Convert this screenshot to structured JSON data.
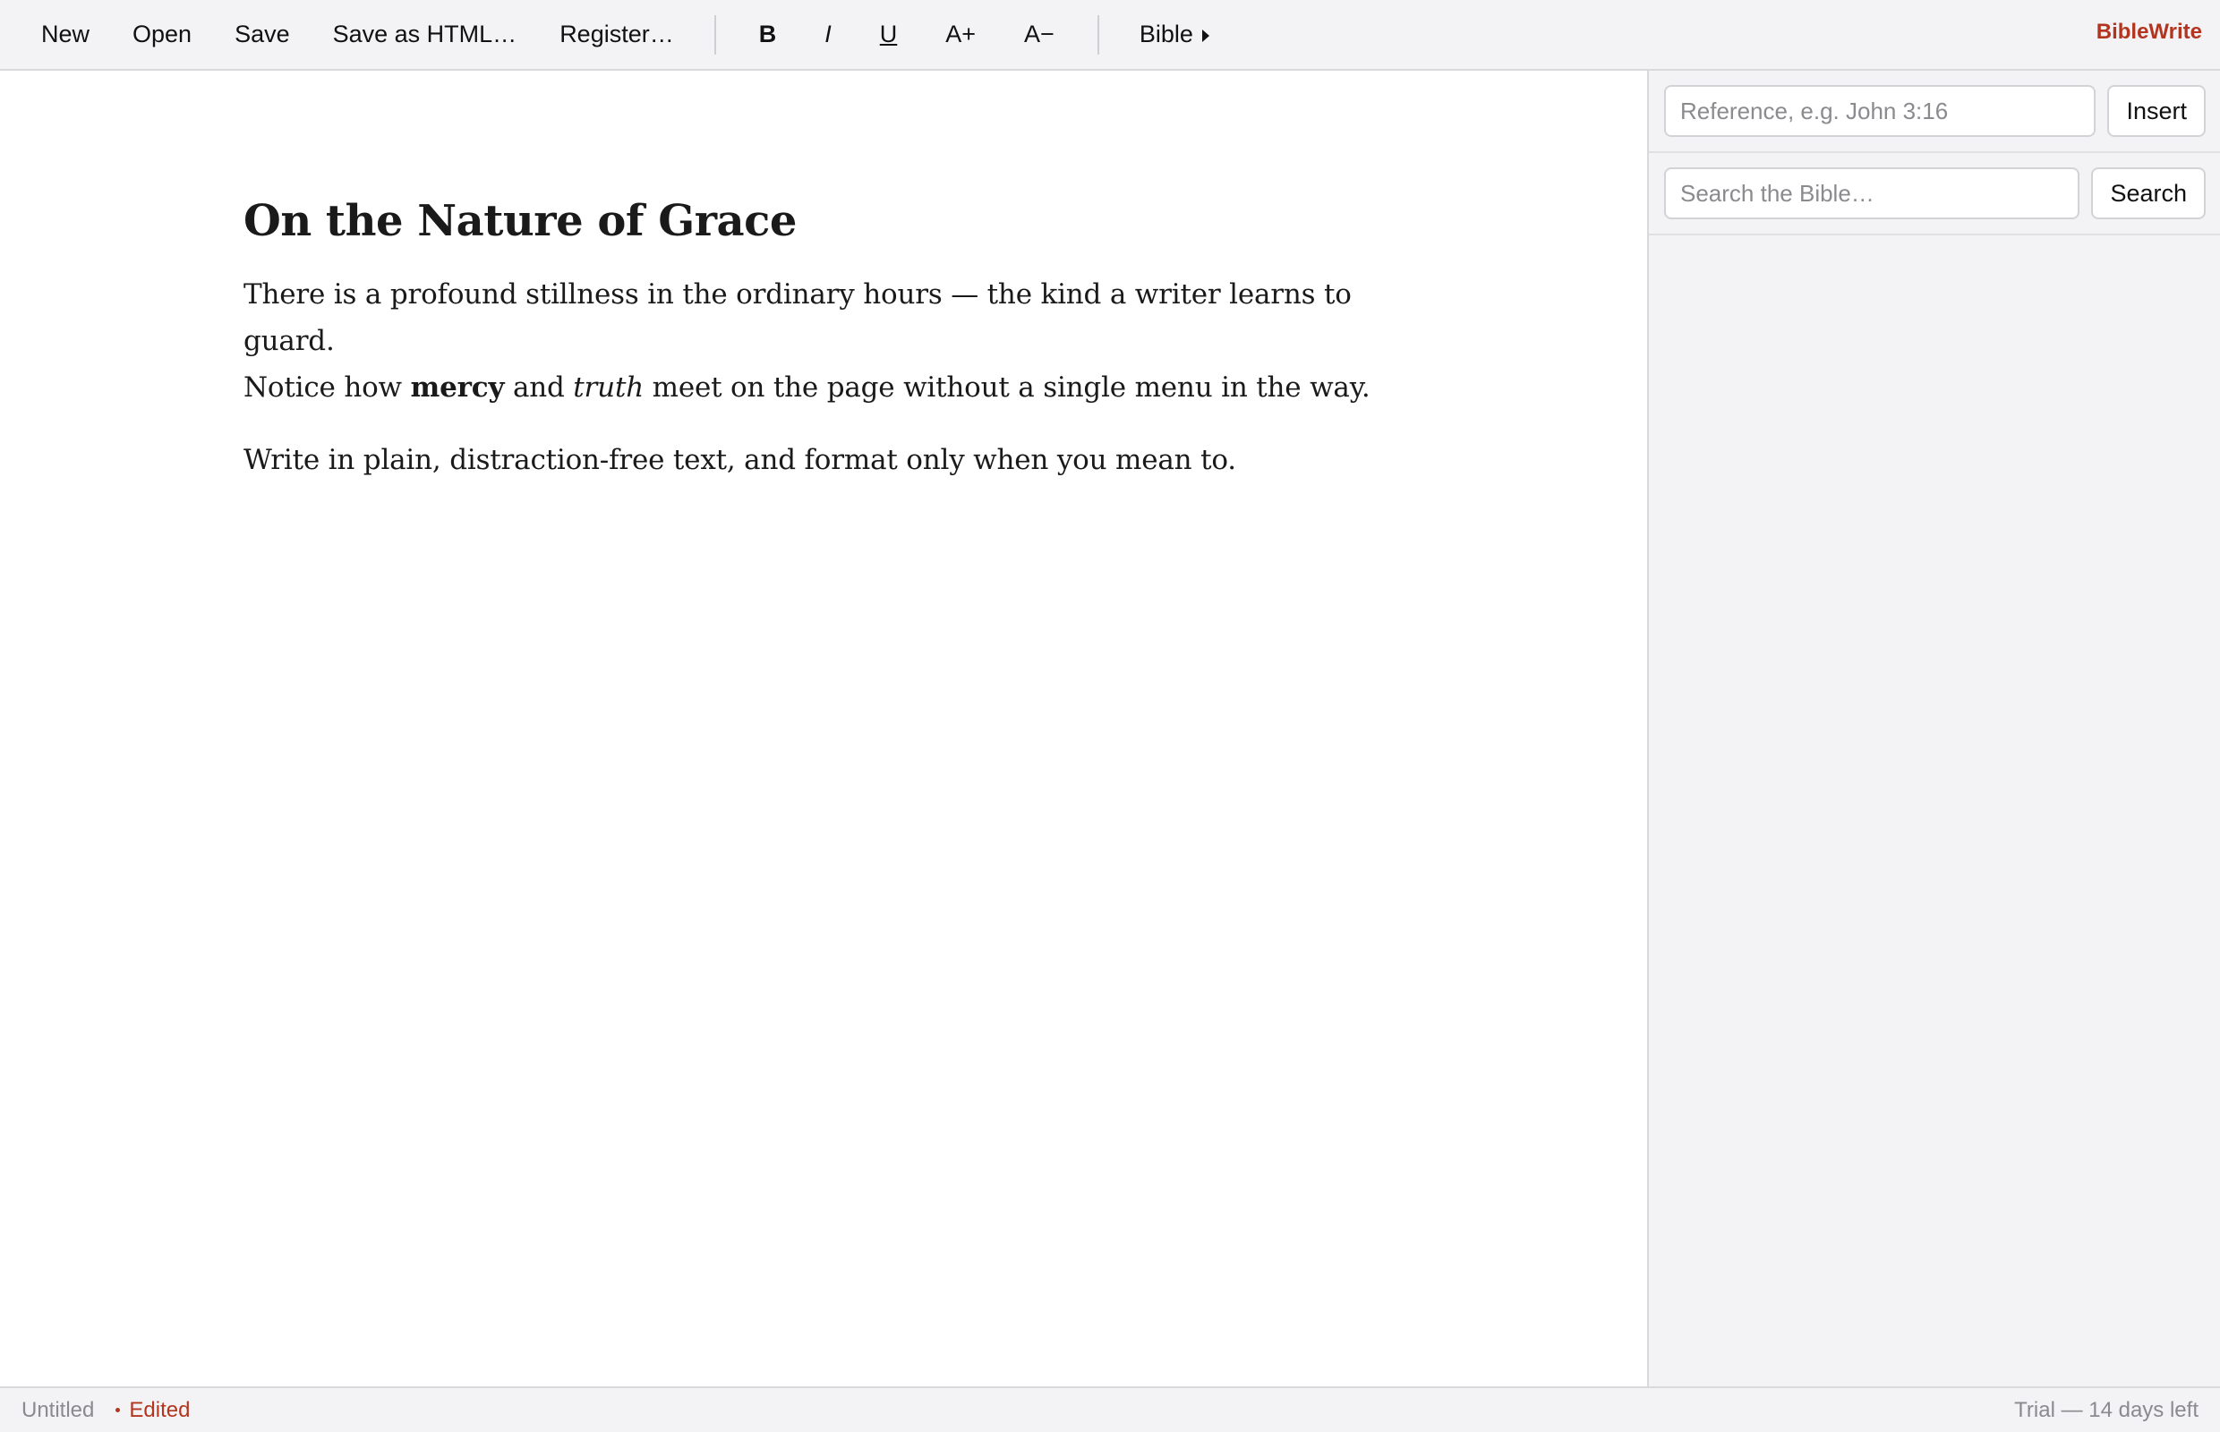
{
  "toolbar": {
    "file_buttons": {
      "new": "New",
      "open": "Open",
      "save": "Save",
      "save_html": "Save as HTML…",
      "register": "Register…"
    },
    "format_buttons": {
      "bold": "B",
      "italic": "I",
      "underline": "U",
      "font_larger": "A+",
      "font_smaller": "A−"
    },
    "bible_menu": "Bible",
    "brand": "BibleWrite",
    "brand_color": "#b3351f"
  },
  "document": {
    "title": "On the Nature of Grace",
    "paragraph1": {
      "line1": "There is a profound stillness in the ordinary hours — the kind a writer learns to guard.",
      "pre": "Notice how ",
      "bold": "mercy",
      "mid": " and ",
      "italic": "truth",
      "post": " meet on the page without a single menu in the way."
    },
    "paragraph2": "Write in plain, distraction-free text, and format only when you mean to."
  },
  "sidebar": {
    "reference_placeholder": "Reference, e.g. John 3:16",
    "insert_label": "Insert",
    "search_placeholder": "Search the Bible…",
    "search_label": "Search"
  },
  "statusbar": {
    "filename": "Untitled",
    "edited": "Edited",
    "trial": "Trial — 14 days left"
  }
}
